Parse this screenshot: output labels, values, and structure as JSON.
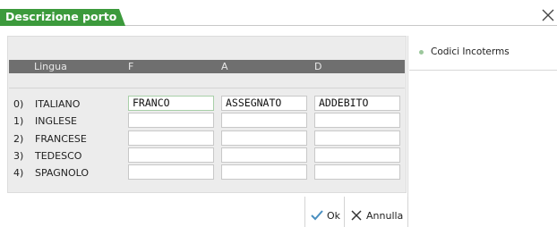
{
  "window": {
    "title": "Descrizione porto"
  },
  "table": {
    "headers": {
      "lingua": "Lingua",
      "f": "F",
      "a": "A",
      "d": "D"
    },
    "rows": [
      {
        "num": "0)",
        "lang": "ITALIANO",
        "f": "FRANCO",
        "a": "ASSEGNATO",
        "d": "ADDEBITO"
      },
      {
        "num": "1)",
        "lang": "INGLESE",
        "f": "",
        "a": "",
        "d": ""
      },
      {
        "num": "2)",
        "lang": "FRANCESE",
        "f": "",
        "a": "",
        "d": ""
      },
      {
        "num": "3)",
        "lang": "TEDESCO",
        "f": "",
        "a": "",
        "d": ""
      },
      {
        "num": "4)",
        "lang": "SPAGNOLO",
        "f": "",
        "a": "",
        "d": ""
      }
    ]
  },
  "side": {
    "incoterms": "Codici Incoterms"
  },
  "buttons": {
    "ok": "Ok",
    "annulla": "Annulla"
  },
  "colors": {
    "accent": "#3c9a3c",
    "header_bg": "#6f6f6f"
  }
}
